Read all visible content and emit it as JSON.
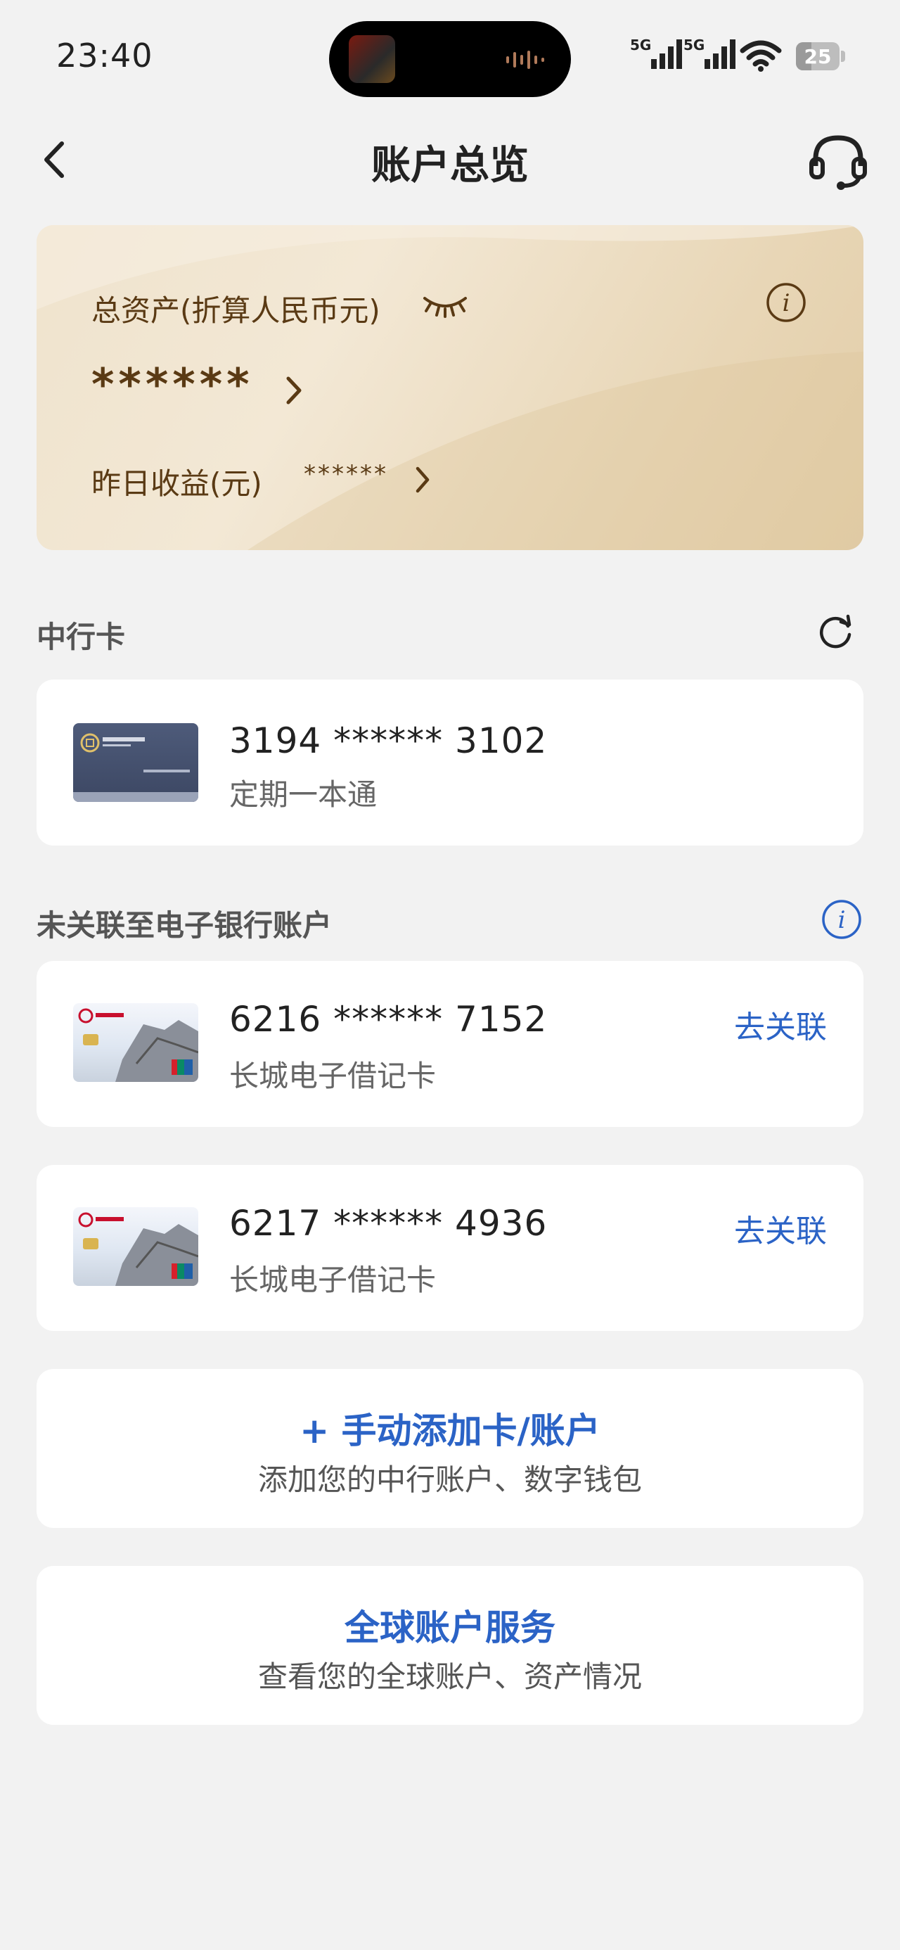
{
  "status_bar": {
    "time": "23:40",
    "battery": "25",
    "net1": "5G",
    "net2": "5G"
  },
  "nav": {
    "title": "账户总览"
  },
  "asset_card": {
    "total_label": "总资产(折算人民币元)",
    "total_value": "******",
    "yesterday_label": "昨日收益(元)",
    "yesterday_value": "******"
  },
  "boc_section": {
    "title": "中行卡",
    "cards": [
      {
        "number": "3194 ****** 3102",
        "name": "定期一本通"
      }
    ]
  },
  "unlinked_section": {
    "title": "未关联至电子银行账户",
    "cards": [
      {
        "number": "6216 ****** 7152",
        "name": "长城电子借记卡",
        "action": "去关联"
      },
      {
        "number": "6217 ****** 4936",
        "name": "长城电子借记卡",
        "action": "去关联"
      }
    ]
  },
  "add_card": {
    "title": "+ 手动添加卡/账户",
    "subtitle": "添加您的中行账户、数字钱包"
  },
  "global_service": {
    "title": "全球账户服务",
    "subtitle": "查看您的全球账户、资产情况"
  },
  "colors": {
    "accent_blue": "#2b63c6",
    "gold_text": "#5a3a14",
    "card_gold": "#e8d6b6"
  },
  "icons": [
    "back-arrow-icon",
    "headset-icon",
    "eye-closed-icon",
    "info-icon",
    "chevron-right-icon",
    "refresh-icon"
  ]
}
